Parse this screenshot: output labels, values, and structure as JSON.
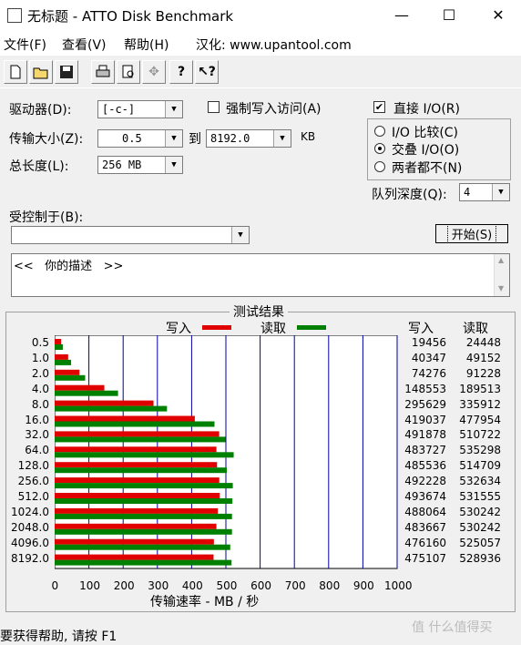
{
  "window": {
    "title": "无标题 - ATTO Disk Benchmark",
    "minimize": "—",
    "maximize": "☐",
    "close": "✕"
  },
  "menu": {
    "file": "文件(F)",
    "view": "查看(V)",
    "help": "帮助(H)",
    "localize": "汉化: www.upantool.com"
  },
  "toolbar": {
    "icons": [
      "new-icon",
      "open-icon",
      "save-icon",
      "print-icon",
      "print-preview-icon",
      "move-icon",
      "help-icon",
      "context-help-icon"
    ]
  },
  "form": {
    "drive_label": "驱动器(D):",
    "drive_value": "[-c-]",
    "force_write_label": "强制写入访问(A)",
    "direct_io_label": "直接 I/O(R)",
    "direct_io_checked": true,
    "transfer_label": "传输大小(Z):",
    "transfer_from": "0.5",
    "transfer_to_label": "到",
    "transfer_to": "8192.0",
    "transfer_unit": "KB",
    "total_length_label": "总长度(L):",
    "total_length": "256 MB",
    "io_compare": "I/O 比较(C)",
    "overlapped_io": "交叠 I/O(O)",
    "neither": "两者都不(N)",
    "queue_depth_label": "队列深度(Q):",
    "queue_depth": "4",
    "controlled_by_label": "受控制于(B):",
    "controlled_by": "",
    "start_button": "开始(S)",
    "description": "<<   你的描述   >>"
  },
  "results": {
    "group_title": "测试结果",
    "legend_write": "写入",
    "legend_read": "读取",
    "col_write": "写入",
    "col_read": "读取",
    "xlabel": "传输速率 - MB / 秒",
    "status": "要获得帮助, 请按 F1",
    "watermark": "值 什么值得买"
  },
  "chart_data": {
    "type": "bar",
    "orientation": "horizontal",
    "categories": [
      "0.5",
      "1.0",
      "2.0",
      "4.0",
      "8.0",
      "16.0",
      "32.0",
      "64.0",
      "128.0",
      "256.0",
      "512.0",
      "1024.0",
      "2048.0",
      "4096.0",
      "8192.0"
    ],
    "series": [
      {
        "name": "写入",
        "color": "#e00000",
        "values": [
          19456,
          40347,
          74276,
          148553,
          295629,
          419037,
          491878,
          483727,
          485536,
          492228,
          493674,
          488064,
          483667,
          476160,
          475107
        ]
      },
      {
        "name": "读取",
        "color": "#008000",
        "values": [
          24448,
          49152,
          91228,
          189513,
          335912,
          477954,
          510722,
          535298,
          514709,
          532634,
          531555,
          530242,
          530242,
          525057,
          528936
        ]
      }
    ],
    "xticks": [
      "0",
      "100",
      "200",
      "300",
      "400",
      "500",
      "600",
      "700",
      "800",
      "900",
      "1000"
    ],
    "xlim": [
      0,
      1000
    ],
    "value_unit": "KB/s"
  }
}
